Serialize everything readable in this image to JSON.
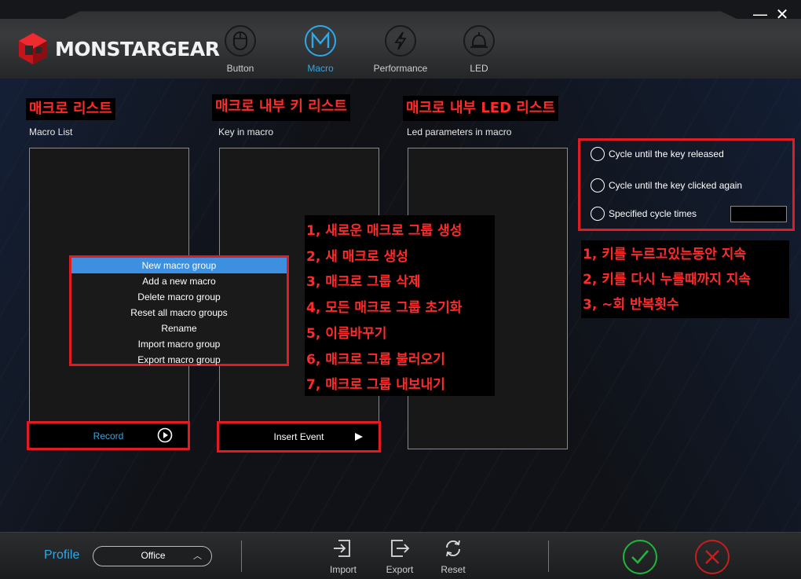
{
  "window": {
    "minimize_glyph": "—",
    "close_glyph": "✕"
  },
  "brand": {
    "logo_text": "MONSTARGEAR",
    "logo_color": "#e01b24"
  },
  "nav": {
    "tabs": [
      {
        "label": "Button",
        "icon": "mouse-icon",
        "active": false
      },
      {
        "label": "Macro",
        "icon": "macro-m-icon",
        "active": true
      },
      {
        "label": "Performance",
        "icon": "lightning-icon",
        "active": false
      },
      {
        "label": "LED",
        "icon": "bell-lamp-icon",
        "active": false
      }
    ],
    "active_color": "#2fa8e8"
  },
  "annotations": {
    "macro_list_kr": "매크로 리스트",
    "key_in_macro_kr": "매크로 내부 키 리스트",
    "led_list_kr": "매크로 내부 LED 리스트",
    "menu_notes": [
      "1, 새로운 매크로 그룹 생성",
      "2, 새 매크로 생성",
      "3, 매크로 그룹 삭제",
      "4, 모든 매크로 그룹 초기화",
      "5, 이름바꾸기",
      "6, 매크로 그룹 불러오기",
      "7, 매크로 그룹 내보내기"
    ],
    "cycle_notes": [
      "1, 키를 누르고있는동안 지속",
      "2, 키를 다시 누를때까지 지속",
      "3, ~회 반복횟수"
    ],
    "color": "#ff2a2a"
  },
  "sections": {
    "macro_list": "Macro List",
    "key_in_macro": "Key in macro",
    "led_params": "Led parameters in macro"
  },
  "buttons": {
    "record": "Record",
    "insert_event": "Insert Event"
  },
  "context_menu": {
    "items": [
      {
        "label": "New macro group",
        "selected": true
      },
      {
        "label": "Add a new macro",
        "selected": false
      },
      {
        "label": "Delete macro group",
        "selected": false
      },
      {
        "label": "Reset all macro groups",
        "selected": false
      },
      {
        "label": "Rename",
        "selected": false
      },
      {
        "label": "Import macro group",
        "selected": false
      },
      {
        "label": "Export macro group",
        "selected": false
      }
    ]
  },
  "cycle_options": {
    "items": [
      {
        "label": "Cycle until the key released",
        "checked": false
      },
      {
        "label": "Cycle until the key clicked again",
        "checked": false
      },
      {
        "label": "Specified cycle times",
        "checked": false
      }
    ],
    "cycle_times_value": ""
  },
  "footer": {
    "profile_label": "Profile",
    "profile_value": "Office",
    "tools": [
      {
        "label": "Import",
        "icon": "import-icon"
      },
      {
        "label": "Export",
        "icon": "export-icon"
      },
      {
        "label": "Reset",
        "icon": "reset-icon"
      }
    ],
    "ok_color": "#1db83a",
    "cancel_color": "#c81e1e"
  }
}
